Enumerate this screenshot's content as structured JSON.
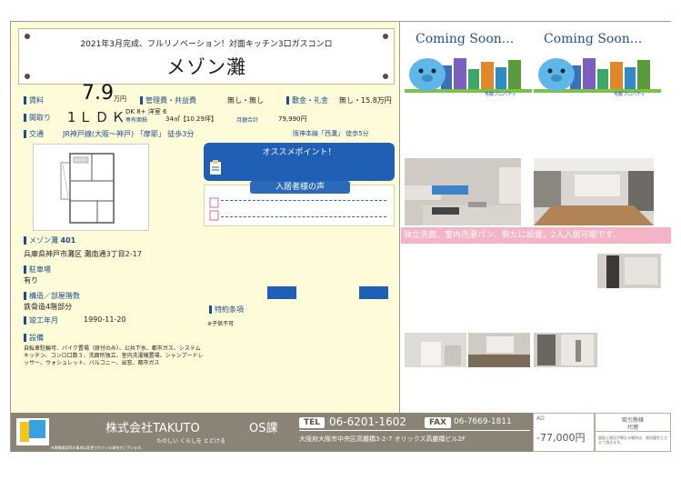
{
  "catch_copy": "2021年3月完成、フルリノベーション！対面キッチン3口ガスコンロ",
  "property_name": "メゾン灘",
  "rent": {
    "label": "賃料",
    "value": "7.9",
    "unit": "万円"
  },
  "mgmt": {
    "label": "管理費・共益費",
    "value": "無し・無し"
  },
  "deposit": {
    "label": "敷金・礼金",
    "value": "無し・15.8万円"
  },
  "layout": {
    "label": "間取り",
    "value": "1ＬＤＫ",
    "detail": "DK 8+  洋室 6",
    "area_label": "専有面積",
    "area_value": "34㎡【10.29坪】",
    "monthly_label": "月額合計",
    "monthly_value": "79,990円"
  },
  "traffic": {
    "label": "交通",
    "line1": "JR神戸線(大阪～神戸) 「摩耶」 徒歩3分",
    "line2": "阪神本線「西灘」 徒歩5分"
  },
  "room": {
    "name": "メゾン灘",
    "number": "401"
  },
  "address": "兵庫県神戸市灘区 灘南通3丁目2-17",
  "parking": {
    "label": "駐車場",
    "value": "有り"
  },
  "structure": {
    "label": "構造／部屋階数",
    "value": "鉄骨造4階部分"
  },
  "built": {
    "label": "竣工年月",
    "value": "1990-11-20"
  },
  "special": {
    "label": "特約条項",
    "value": "※子供不可"
  },
  "equipment": {
    "label": "設備",
    "value": "自転車駐輪可、バイク置場（原付のみ）、公共下水、都市ガス、システムキッチン、コンロ口数３、洗面所独立、室内洗濯機置場、シャンプードレッサー、ウォシュレット、バルコニー、出窓、都市ガス"
  },
  "osusume_title": "オススメポイント！",
  "voice_title": "入居者様の声",
  "coming_soon": "Coming Soon...",
  "photo_brand": "宅都プロパティ",
  "caption": "独立洗面、室内洗濯パン、新たに設置。2人入居可能です。",
  "footer": {
    "company": "株式会社TAKUTO",
    "dept": "OS課",
    "tagline": "たのしい くらしを とどける",
    "tel_label": "TEL",
    "tel": "06-6201-1602",
    "fax_label": "FAX",
    "fax": "06-7669-1811",
    "address": "大阪府大阪市中央区高麗橋3-2-7 オリックス高麗橋ビル2F",
    "ad_label": "AD",
    "ad_value": "-77,000円",
    "deal_label": "取引態様",
    "deal_value": "代理",
    "note": "※建築確認等の事項は変更されている場合がございます。",
    "deal_note": "図面と現況が異なる場合は、現況優先とさせて頂きます。"
  },
  "colors": {
    "accent": "#1f5fb5",
    "pink": "#f5b3c8",
    "cream": "#fdfbd8",
    "footer": "#8a8477"
  }
}
